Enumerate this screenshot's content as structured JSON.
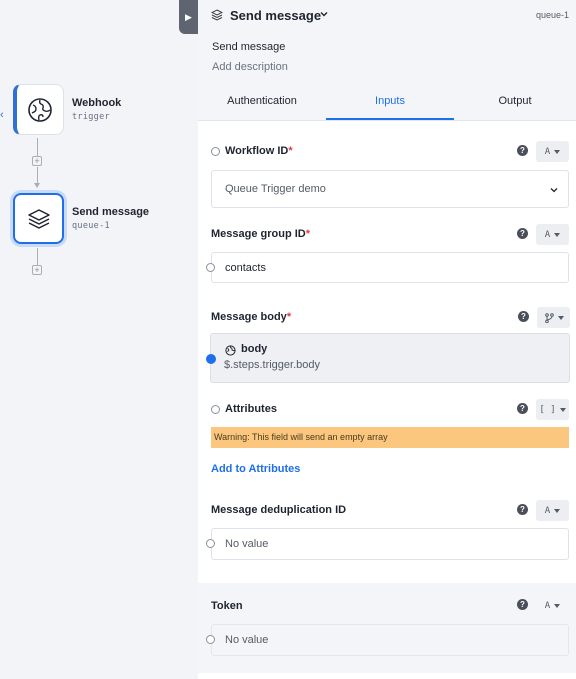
{
  "canvas": {
    "nodes": [
      {
        "title": "Webhook",
        "subtitle": "trigger",
        "icon": "globe-icon"
      },
      {
        "title": "Send message",
        "subtitle": "queue-1",
        "icon": "layers-icon"
      }
    ]
  },
  "panel": {
    "header": {
      "title": "Send message",
      "id": "queue-1",
      "name": "Send message",
      "description_placeholder": "Add description"
    },
    "tabs": [
      {
        "label": "Authentication"
      },
      {
        "label": "Inputs",
        "active": true
      },
      {
        "label": "Output"
      }
    ],
    "fields": {
      "workflow_id": {
        "label": "Workflow ID",
        "required": "*",
        "value": "Queue Trigger demo",
        "type_glyph": "A"
      },
      "message_group_id": {
        "label": "Message group ID",
        "required": "*",
        "value": "contacts",
        "type_glyph": "A"
      },
      "message_body": {
        "label": "Message body",
        "required": "*",
        "ref_name": "body",
        "ref_path": "$.steps.trigger.body",
        "type_glyph": "branch-icon"
      },
      "attributes": {
        "label": "Attributes",
        "warning": "Warning: This field will send an empty array",
        "add_label": "Add to Attributes",
        "type_glyph": "[ ]"
      },
      "dedup_id": {
        "label": "Message deduplication ID",
        "placeholder": "No value",
        "type_glyph": "A"
      },
      "token": {
        "label": "Token",
        "placeholder": "No value",
        "type_glyph": "A"
      }
    }
  },
  "colors": {
    "accent": "#1f6feb",
    "required": "#e0394b",
    "warning_bg": "#fbc77e",
    "panel_header_bg": "#f4f5f8"
  }
}
